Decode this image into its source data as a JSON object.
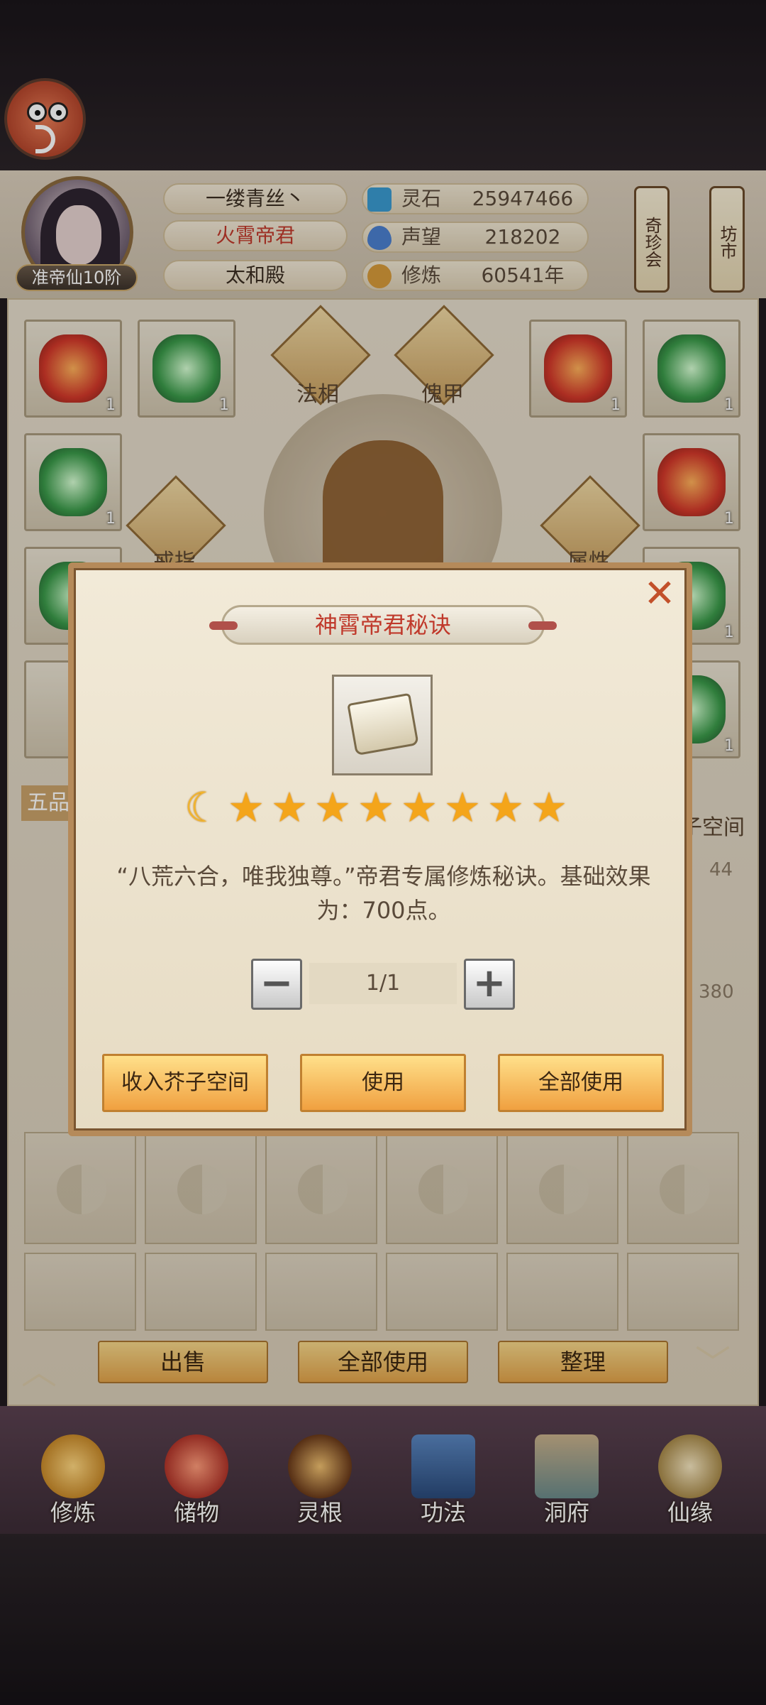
{
  "player": {
    "rank": "准帝仙10阶",
    "name": "一缕青丝丶",
    "title": "火霄帝君",
    "palace": "太和殿"
  },
  "stats": [
    {
      "label": "灵石",
      "value": "25947466",
      "icon": "spirit-stone-icon",
      "color": "#3a9ad0"
    },
    {
      "label": "声望",
      "value": "218202",
      "icon": "prestige-icon",
      "color": "#4b7fcf"
    },
    {
      "label": "修炼",
      "value": "60541年",
      "icon": "cultivation-icon",
      "color": "#d69a3a"
    }
  ],
  "side_tags": {
    "treasure": "奇珍会",
    "market": "坊市"
  },
  "equip_slots": {
    "faxiang": "法相",
    "kuijia": "傀甲",
    "ring": "戒指",
    "attribute": "属性",
    "count": "1"
  },
  "storage": {
    "sort_label": "五品",
    "mustard_space": "芥子空间",
    "count_a": "44",
    "count_b": "380"
  },
  "storage_buttons": {
    "sell": "出售",
    "use_all": "全部使用",
    "organize": "整理"
  },
  "nav": [
    {
      "label": "修炼",
      "icon": "cultivate-icon"
    },
    {
      "label": "储物",
      "icon": "storage-bag-icon"
    },
    {
      "label": "灵根",
      "icon": "spirit-root-icon"
    },
    {
      "label": "功法",
      "icon": "technique-book-icon"
    },
    {
      "label": "洞府",
      "icon": "cave-dwelling-icon"
    },
    {
      "label": "仙缘",
      "icon": "immortal-fate-icon"
    }
  ],
  "dialog": {
    "title": "神霄帝君秘诀",
    "stars": 8,
    "description": "“八荒六合，唯我独尊。”帝君专属修炼秘诀。基础效果为：700点。",
    "quantity": "1/1",
    "minus": "−",
    "plus": "+",
    "close": "✕",
    "buttons": {
      "store": "收入芥子空间",
      "use": "使用",
      "use_all": "全部使用"
    }
  },
  "colors": {
    "accent_gold": "#f0a040",
    "title_red": "#c0392b",
    "star": "#f4a51a"
  }
}
